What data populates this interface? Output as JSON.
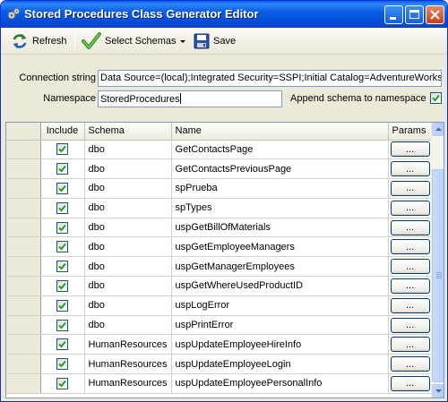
{
  "window": {
    "title": "Stored Procedures Class Generator Editor",
    "accent_color": "#0A5FE5",
    "icon": "gears-icon"
  },
  "toolbar": {
    "refresh_label": "Refresh",
    "refresh_icon": "refresh-icon",
    "select_schemas_label": "Select Schemas",
    "select_schemas_icon": "checkmark-icon",
    "save_label": "Save",
    "save_icon": "floppy-disk-icon"
  },
  "form": {
    "connection_label": "Connection string",
    "connection_value": "Data Source=(local);Integrated Security=SSPI;Initial Catalog=AdventureWorks",
    "namespace_label": "Namespace",
    "namespace_value": "StoredProcedures",
    "append_label": "Append schema to namespace",
    "append_checked": true
  },
  "grid": {
    "columns": [
      "",
      "Include",
      "Schema",
      "Name",
      "Params"
    ],
    "button_label": "...",
    "rows": [
      {
        "include": true,
        "schema": "dbo",
        "name": "GetContactsPage"
      },
      {
        "include": true,
        "schema": "dbo",
        "name": "GetContactsPreviousPage"
      },
      {
        "include": true,
        "schema": "dbo",
        "name": "spPrueba"
      },
      {
        "include": true,
        "schema": "dbo",
        "name": "spTypes"
      },
      {
        "include": true,
        "schema": "dbo",
        "name": "uspGetBillOfMaterials"
      },
      {
        "include": true,
        "schema": "dbo",
        "name": "uspGetEmployeeManagers"
      },
      {
        "include": true,
        "schema": "dbo",
        "name": "uspGetManagerEmployees"
      },
      {
        "include": true,
        "schema": "dbo",
        "name": "uspGetWhereUsedProductID"
      },
      {
        "include": true,
        "schema": "dbo",
        "name": "uspLogError"
      },
      {
        "include": true,
        "schema": "dbo",
        "name": "uspPrintError"
      },
      {
        "include": true,
        "schema": "HumanResources",
        "name": "uspUpdateEmployeeHireInfo"
      },
      {
        "include": true,
        "schema": "HumanResources",
        "name": "uspUpdateEmployeeLogin"
      },
      {
        "include": true,
        "schema": "HumanResources",
        "name": "uspUpdateEmployeePersonalInfo"
      }
    ]
  }
}
